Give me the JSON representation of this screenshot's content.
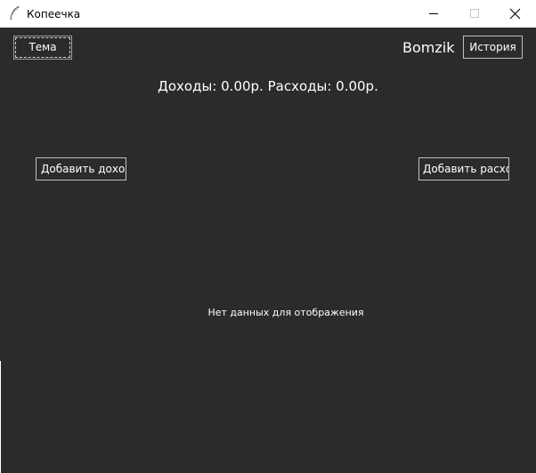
{
  "window": {
    "title": "Копеечка",
    "icon": "feather-icon",
    "controls": {
      "minimize": "minimize-icon",
      "maximize": "maximize-icon",
      "close": "close-icon"
    }
  },
  "header": {
    "theme_label": "Тема",
    "username": "Bomzik",
    "history_label": "История"
  },
  "summary": {
    "text": "Доходы: 0.00р. Расходы: 0.00р."
  },
  "actions": {
    "add_income_label": "Добавить доход",
    "add_expense_label": "Добавить расход"
  },
  "chart_area": {
    "empty_message": "Нет данных для отображения"
  },
  "colors": {
    "background": "#2b2b2b",
    "text": "#ffffff",
    "titlebar": "#ffffff"
  }
}
